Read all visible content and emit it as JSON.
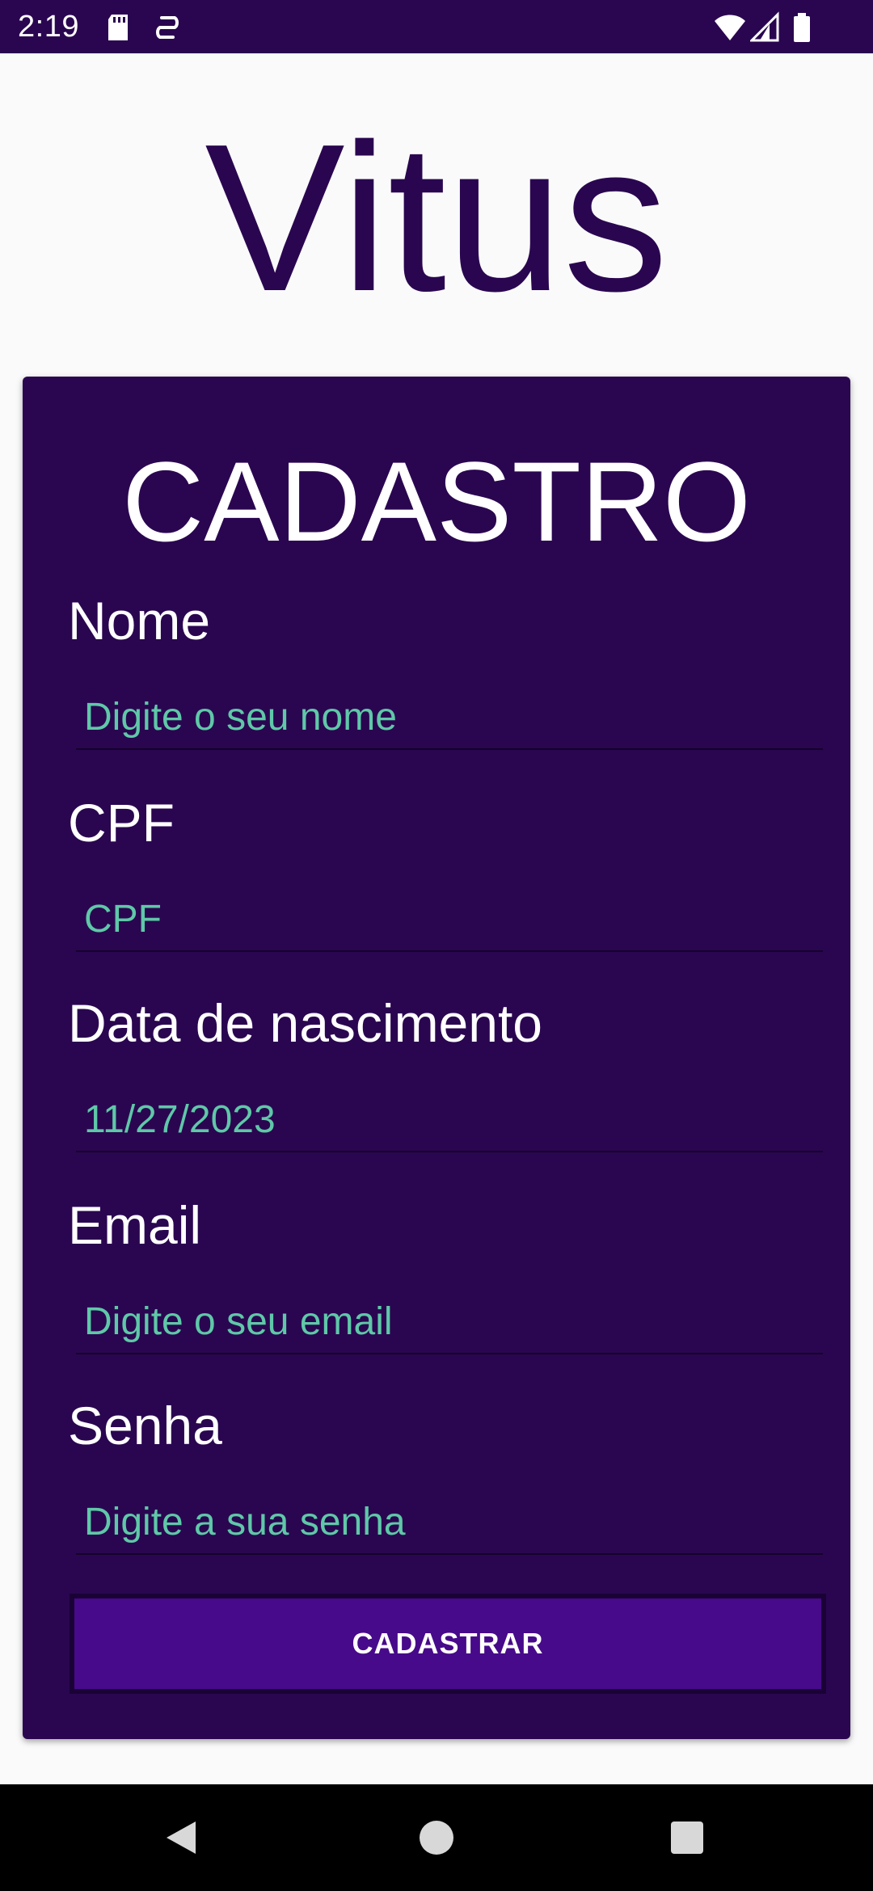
{
  "status_bar": {
    "time": "2:19",
    "icons": [
      "sd-card-icon",
      "sync-icon",
      "wifi-icon",
      "signal-icon",
      "battery-icon"
    ]
  },
  "app": {
    "title": "Vitus"
  },
  "form": {
    "title": "CADASTRO",
    "fields": [
      {
        "label": "Nome",
        "placeholder": "Digite o seu nome",
        "value": ""
      },
      {
        "label": "CPF",
        "placeholder": "CPF",
        "value": ""
      },
      {
        "label": "Data de nascimento",
        "placeholder": "",
        "value": "11/27/2023"
      },
      {
        "label": "Email",
        "placeholder": "Digite o seu email",
        "value": ""
      },
      {
        "label": "Senha",
        "placeholder": "Digite a sua senha",
        "value": ""
      }
    ],
    "submit_label": "CADASTRAR"
  },
  "nav_bar": {
    "icons": [
      "back-icon",
      "home-icon",
      "recents-icon"
    ]
  },
  "colors": {
    "primary_dark": "#2a0650",
    "button": "#470a8a",
    "hint_text": "#5fc8a8",
    "background": "#fafafa"
  }
}
